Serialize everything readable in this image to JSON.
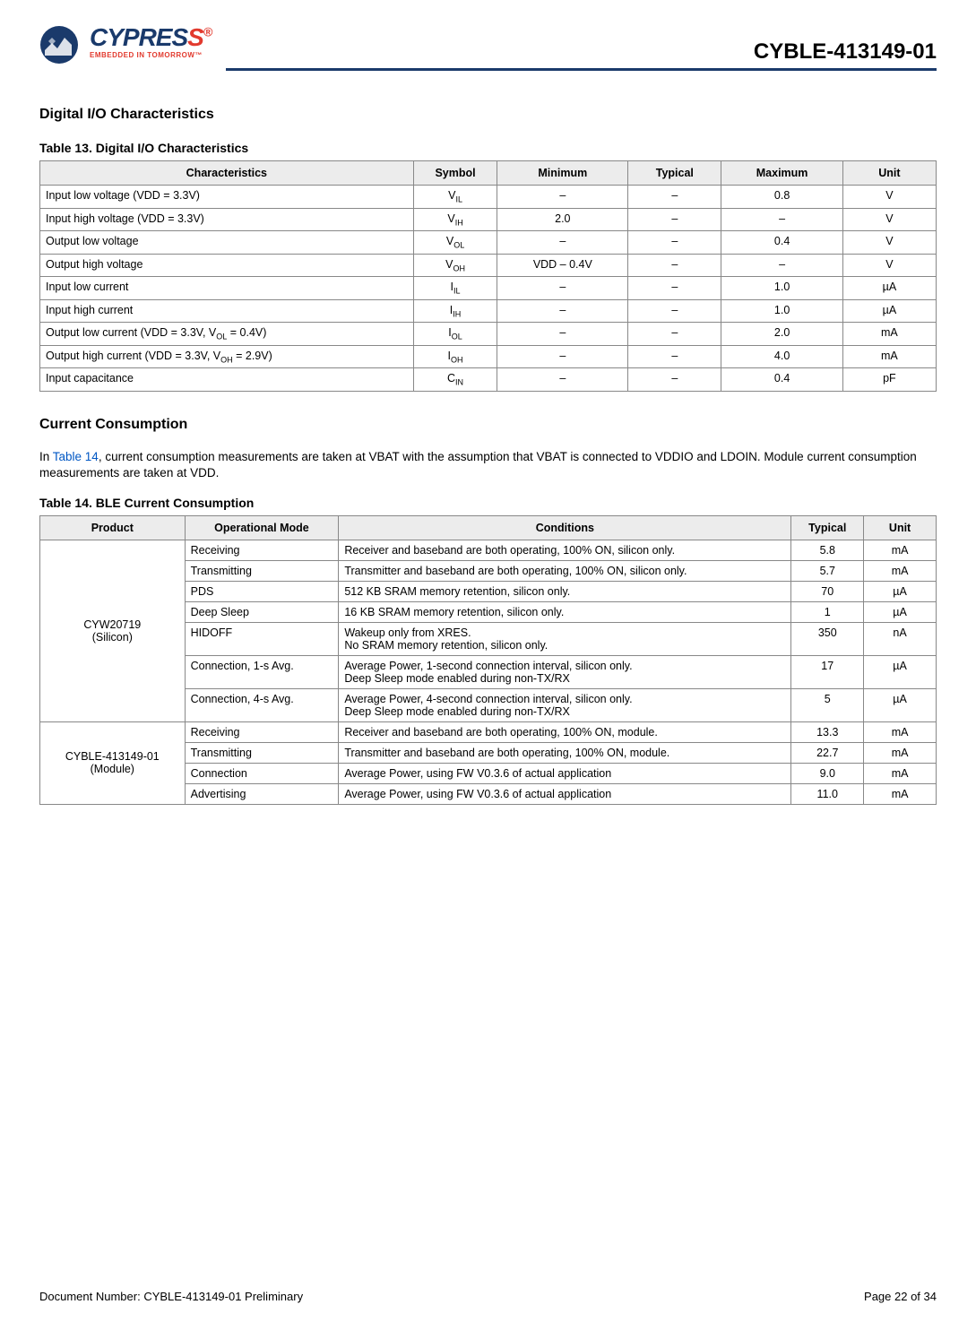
{
  "header": {
    "logo_word_pre": "CYPRES",
    "logo_word_accent": "S",
    "logo_tagline": "EMBEDDED IN TOMORROW™",
    "doc_id": "CYBLE-413149-01"
  },
  "section1": {
    "title": "Digital I/O Characteristics",
    "table_title": "Table 13.  Digital I/O Characteristics",
    "cols": [
      "Characteristics",
      "Symbol",
      "Minimum",
      "Typical",
      "Maximum",
      "Unit"
    ],
    "rows": [
      {
        "char": "Input low voltage (VDD = 3.3V)",
        "sym": [
          "V",
          "IL"
        ],
        "min": "–",
        "typ": "–",
        "max": "0.8",
        "unit": "V"
      },
      {
        "char": "Input high voltage (VDD = 3.3V)",
        "sym": [
          "V",
          "IH"
        ],
        "min": "2.0",
        "typ": "–",
        "max": "–",
        "unit": "V"
      },
      {
        "char": "Output low voltage",
        "sym": [
          "V",
          "OL"
        ],
        "min": "–",
        "typ": "–",
        "max": "0.4",
        "unit": "V"
      },
      {
        "char": "Output high voltage",
        "sym": [
          "V",
          "OH"
        ],
        "min": "VDD – 0.4V",
        "typ": "–",
        "max": "–",
        "unit": "V"
      },
      {
        "char": "Input low current",
        "sym": [
          "I",
          "IL"
        ],
        "min": "–",
        "typ": "–",
        "max": "1.0",
        "unit": "µA"
      },
      {
        "char": "Input high current",
        "sym": [
          "I",
          "IH"
        ],
        "min": "–",
        "typ": "–",
        "max": "1.0",
        "unit": "µA"
      },
      {
        "char_html": "Output low current (VDD = 3.3V, V<sub class='sub'>OL</sub> = 0.4V)",
        "sym": [
          "I",
          "OL"
        ],
        "min": "–",
        "typ": "–",
        "max": "2.0",
        "unit": "mA"
      },
      {
        "char_html": "Output high current (VDD = 3.3V, V<sub class='sub'>OH</sub> = 2.9V)",
        "sym": [
          "I",
          "OH"
        ],
        "min": "–",
        "typ": "–",
        "max": "4.0",
        "unit": "mA"
      },
      {
        "char": "Input capacitance",
        "sym": [
          "C",
          "IN"
        ],
        "min": "–",
        "typ": "–",
        "max": "0.4",
        "unit": "pF"
      }
    ]
  },
  "section2": {
    "title": "Current Consumption",
    "para_pre": "In ",
    "para_link": "Table 14",
    "para_post": ", current consumption measurements are taken at VBAT with the assumption that VBAT is connected to VDDIO and LDOIN. Module current consumption measurements are taken at VDD.",
    "table_title": "Table 14.  BLE Current Consumption",
    "cols": [
      "Product",
      "Operational Mode",
      "Conditions",
      "Typical",
      "Unit"
    ],
    "groups": [
      {
        "product": "CYW20719\n(Silicon)",
        "rows": [
          {
            "mode": "Receiving",
            "cond": "Receiver and baseband are both operating, 100% ON, silicon only.",
            "typ": "5.8",
            "unit": "mA"
          },
          {
            "mode": "Transmitting",
            "cond": "Transmitter and baseband are both operating, 100% ON, silicon only.",
            "typ": "5.7",
            "unit": "mA"
          },
          {
            "mode": "PDS",
            "cond": "512 KB SRAM memory retention, silicon only.",
            "typ": "70",
            "unit": "µA"
          },
          {
            "mode": "Deep Sleep",
            "cond": "16 KB SRAM memory retention, silicon only.",
            "typ": "1",
            "unit": "µA"
          },
          {
            "mode": "HIDOFF",
            "cond": "Wakeup only from XRES.\nNo SRAM memory retention, silicon only.",
            "typ": "350",
            "unit": "nA"
          },
          {
            "mode": "Connection, 1-s Avg.",
            "cond": "Average Power, 1-second connection interval, silicon only.\nDeep Sleep mode enabled during non-TX/RX",
            "typ": "17",
            "unit": "µA"
          },
          {
            "mode": "Connection, 4-s Avg.",
            "cond": "Average Power, 4-second connection interval, silicon only.\nDeep Sleep mode enabled during non-TX/RX",
            "typ": "5",
            "unit": "µA"
          }
        ]
      },
      {
        "product": "CYBLE-413149-01\n(Module)",
        "rows": [
          {
            "mode": "Receiving",
            "cond": "Receiver and baseband are both operating, 100% ON, module.",
            "typ": "13.3",
            "unit": "mA"
          },
          {
            "mode": "Transmitting",
            "cond": "Transmitter and baseband are both operating, 100% ON, module.",
            "typ": "22.7",
            "unit": "mA"
          },
          {
            "mode": "Connection",
            "cond": "Average Power, using FW V0.3.6 of actual application",
            "typ": "9.0",
            "unit": "mA"
          },
          {
            "mode": "Advertising",
            "cond": "Average Power, using FW V0.3.6 of actual application",
            "typ": "11.0",
            "unit": "mA"
          }
        ]
      }
    ]
  },
  "footer": {
    "left": "Document Number:  CYBLE-413149-01 Preliminary",
    "right": "Page 22 of 34"
  },
  "table13_colwidths": [
    "40%",
    "9%",
    "14%",
    "10%",
    "13%",
    "10%"
  ],
  "table14_colwidths": [
    "16%",
    "17%",
    "50%",
    "8%",
    "8%"
  ]
}
